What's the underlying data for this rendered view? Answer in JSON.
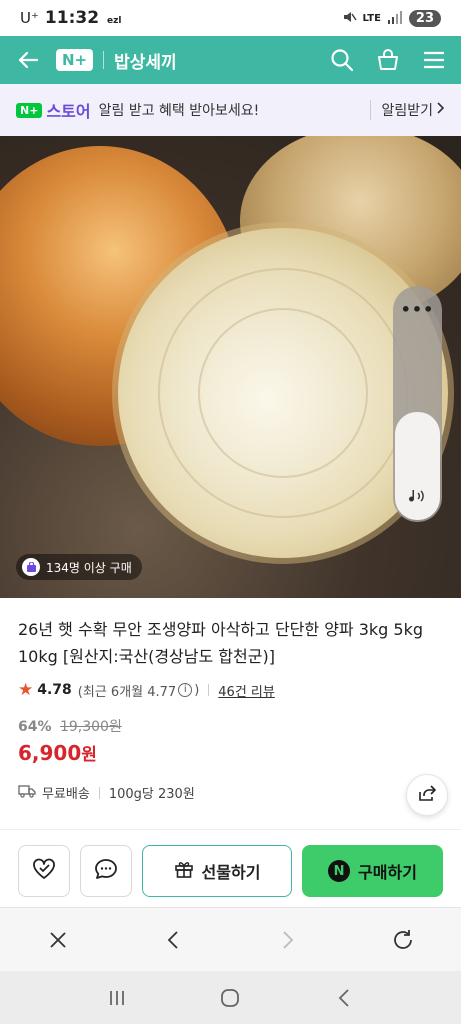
{
  "status_bar": {
    "carrier": "U⁺",
    "time": "11:32",
    "extra": "ezl",
    "network": "LTE",
    "battery": "23"
  },
  "header": {
    "brand_logo": "N+",
    "store_name": "밥상세끼"
  },
  "promo": {
    "logo_box": "N+",
    "logo_text": "스토어",
    "text": "알림 받고 혜택 받아보세요!",
    "action": "알림받기"
  },
  "hero": {
    "purchase_badge": "134명 이상 구매"
  },
  "product": {
    "title": "26년 햇 수확 무안 조생양파 아삭하고 단단한 양파 3kg 5kg 10kg [원산지:국산(경상남도 합천군)]",
    "rating": "4.78",
    "rating_detail_prefix": "(최근 6개월 4.77",
    "rating_detail_suffix": ")",
    "reviews": "46건 리뷰",
    "discount": "64%",
    "original_price": "19,300원",
    "price": "6,900",
    "price_unit": "원",
    "shipping": "무료배송",
    "unit_price": "100g당 230원"
  },
  "actions": {
    "gift_label": "선물하기",
    "buy_label": "구매하기",
    "buy_icon": "N"
  },
  "icons": {
    "back": "back-arrow-icon",
    "search": "search-icon",
    "cart": "cart-icon",
    "menu": "menu-icon",
    "wish": "heart-check-icon",
    "chat": "chat-bubble-icon",
    "share": "share-icon",
    "gift": "gift-icon",
    "close": "close-icon",
    "prev": "chevron-left-icon",
    "next": "chevron-right-icon",
    "reload": "reload-icon"
  },
  "colors": {
    "header_bg": "#3eb8a3",
    "promo_bg": "#f1f0fb",
    "price_red": "#d6252d",
    "buy_green": "#3ecc6a",
    "star": "#e8552f"
  }
}
